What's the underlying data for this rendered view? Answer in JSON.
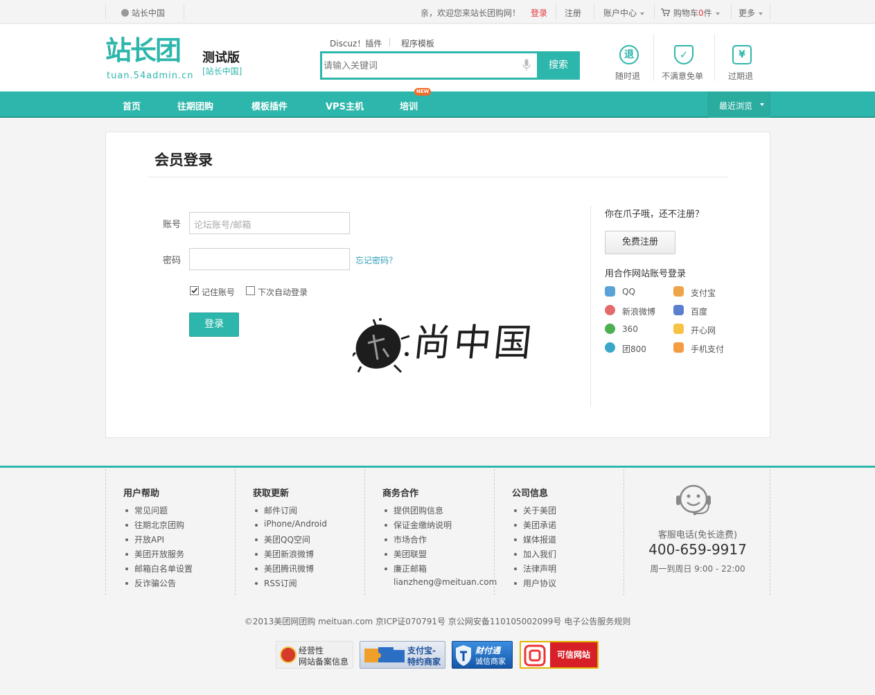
{
  "topbar": {
    "site_name": "站长中国",
    "welcome": "亲，欢迎您来站长团购网！",
    "login": "登录",
    "register": "注册",
    "account_center": "账户中心",
    "cart_prefix": "购物车",
    "cart_count": "0",
    "cart_suffix": "件",
    "more": "更多"
  },
  "header": {
    "logo_main": "站长团",
    "logo_domain": "tuan.54admin.cn",
    "edition": "测试版",
    "edition_sub": "[站长中国]",
    "hot_links": [
      "Discuz！插件",
      "程序模板"
    ],
    "search_placeholder": "请输入关键词",
    "search_button": "搜索",
    "promises": [
      {
        "label": "随时退",
        "glyph": "退"
      },
      {
        "label": "不满意免单",
        "glyph": "✓"
      },
      {
        "label": "过期退",
        "glyph": "¥"
      }
    ]
  },
  "nav": {
    "items": [
      "首页",
      "往期团购",
      "模板插件",
      "VPS主机",
      "培训"
    ],
    "new_badge": "NEW",
    "recent": "最近浏览"
  },
  "login": {
    "title": "会员登录",
    "account_label": "账号",
    "account_placeholder": "论坛账号/邮箱",
    "password_label": "密码",
    "password_value": "",
    "forgot": "忘记密码？",
    "remember": "记住账号",
    "remember_checked": true,
    "auto_login": "下次自动登录",
    "auto_login_checked": false,
    "submit": "登录"
  },
  "watermark": {
    "text": "尚中国"
  },
  "side": {
    "prompt": "你在爪子哦，还不注册？",
    "register_button": "免费注册",
    "partner_title": "用合作网站账号登录",
    "partners": [
      {
        "name": "QQ",
        "color": "#5aa3d6"
      },
      {
        "name": "支付宝",
        "color": "#f0a44a"
      },
      {
        "name": "新浪微博",
        "color": "#e36b6b"
      },
      {
        "name": "百度",
        "color": "#5b7fcf"
      },
      {
        "name": "360",
        "color": "#4caf50"
      },
      {
        "name": "开心网",
        "color": "#f6c344"
      },
      {
        "name": "团800",
        "color": "#3aa7c8"
      },
      {
        "name": "手机支付",
        "color": "#f39c40"
      }
    ]
  },
  "footer": {
    "columns": [
      {
        "title": "用户帮助",
        "links": [
          "常见问题",
          "往期北京团购",
          "开放API",
          "美团开放服务",
          "邮箱白名单设置",
          "反诈骗公告"
        ]
      },
      {
        "title": "获取更新",
        "links": [
          "邮件订阅",
          "iPhone/Android",
          "美团QQ空间",
          "美团新浪微博",
          "美团腾讯微博",
          "RSS订阅"
        ]
      },
      {
        "title": "商务合作",
        "links": [
          "提供团购信息",
          "保证金缴纳说明",
          "市场合作",
          "美团联盟",
          "廉正邮箱"
        ],
        "extra": "lianzheng@meituan.com"
      },
      {
        "title": "公司信息",
        "links": [
          "关于美团",
          "美团承诺",
          "媒体报道",
          "加入我们",
          "法律声明",
          "用户协议"
        ]
      }
    ],
    "service_label": "客服电话(免长途费)",
    "phone": "400-659-9917",
    "hours": "周一到周日 9:00 - 22:00",
    "copyright": "©2013美团网团购 meituan.com 京ICP证070791号 京公网安备110105002099号 电子公告服务规则",
    "badges": [
      {
        "line1": "经营性",
        "line2": "网站备案信息"
      },
      {
        "line1": "支付宝-",
        "line2": "特约商家"
      },
      {
        "line1": "财付通",
        "line2": "诚信商家"
      },
      {
        "line1": "可信网站"
      }
    ]
  }
}
